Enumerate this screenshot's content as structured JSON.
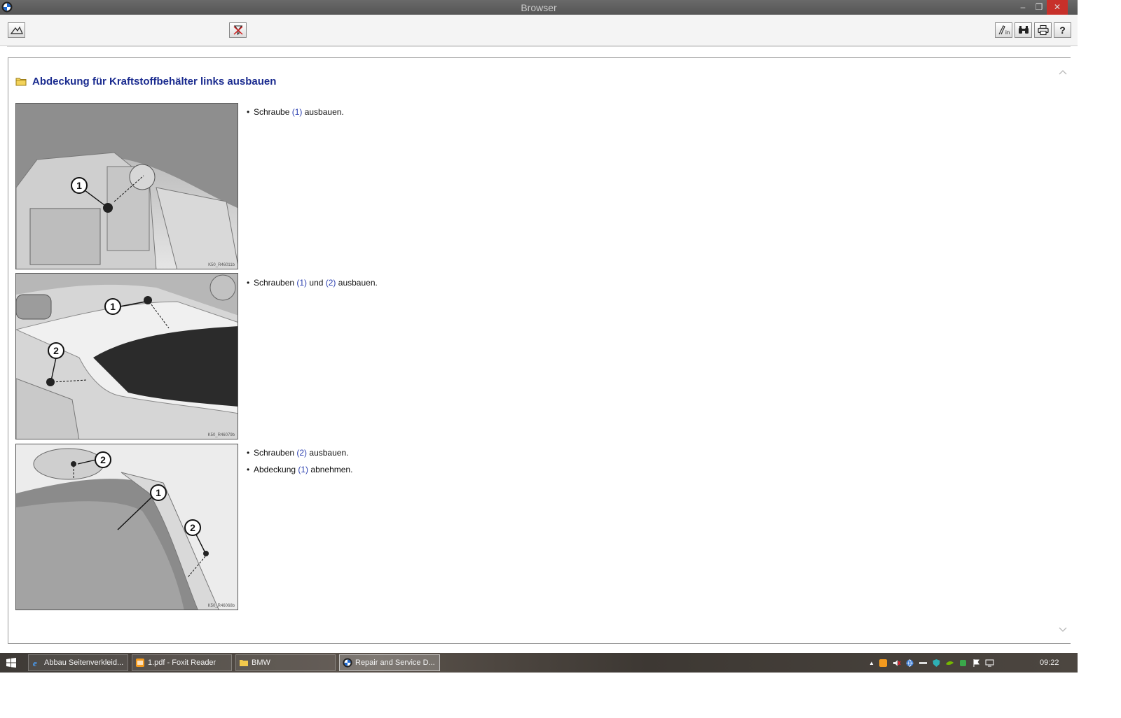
{
  "window": {
    "title": "Browser",
    "min_glyph": "–",
    "max_glyph": "❐",
    "close_glyph": "✕"
  },
  "toolbar": {
    "left_buttons": [
      {
        "icon": "home-icon"
      },
      {
        "icon": "cancel-filter-icon"
      }
    ],
    "right_buttons": [
      {
        "icon": "sign-in-icon"
      },
      {
        "icon": "binoculars-icon"
      },
      {
        "icon": "printer-icon"
      },
      {
        "icon": "help-icon"
      }
    ],
    "help_glyph": "?"
  },
  "document": {
    "heading": "Abdeckung für Kraftstoffbehälter links ausbauen",
    "figures": [
      {
        "code": "K50_R46011b",
        "callouts": [
          "1"
        ]
      },
      {
        "code": "K50_R46079b",
        "callouts": [
          "1",
          "2"
        ]
      },
      {
        "code": "K50_R46068b",
        "callouts": [
          "1",
          "2",
          "2"
        ]
      }
    ],
    "steps": [
      {
        "bullet": "•",
        "before": "Schraube ",
        "ref1": "(1)",
        "middle": " ausbauen.",
        "ref2": "",
        "after": ""
      },
      {
        "bullet": "•",
        "before": "Schrauben ",
        "ref1": "(1)",
        "middle": " und ",
        "ref2": "(2)",
        "after": " ausbauen."
      },
      {
        "bullet": "•",
        "before": "Schrauben ",
        "ref1": "(2)",
        "middle": " ausbauen.",
        "ref2": "",
        "after": ""
      },
      {
        "bullet": "•",
        "before": "Abdeckung ",
        "ref1": "(1)",
        "middle": " abnehmen.",
        "ref2": "",
        "after": ""
      }
    ],
    "colors": {
      "heading": "#1a2b8f",
      "reference": "#2b3fb0"
    }
  },
  "taskbar": {
    "items": [
      {
        "label": "Abbau Seitenverkleid...",
        "icon": "ie-icon"
      },
      {
        "label": "1.pdf - Foxit Reader",
        "icon": "foxit-icon"
      },
      {
        "label": "BMW",
        "icon": "folder-icon"
      },
      {
        "label": "Repair and Service D...",
        "icon": "bmw-icon",
        "active": true
      }
    ],
    "tray_expand": "▲",
    "clock": "09:22"
  }
}
